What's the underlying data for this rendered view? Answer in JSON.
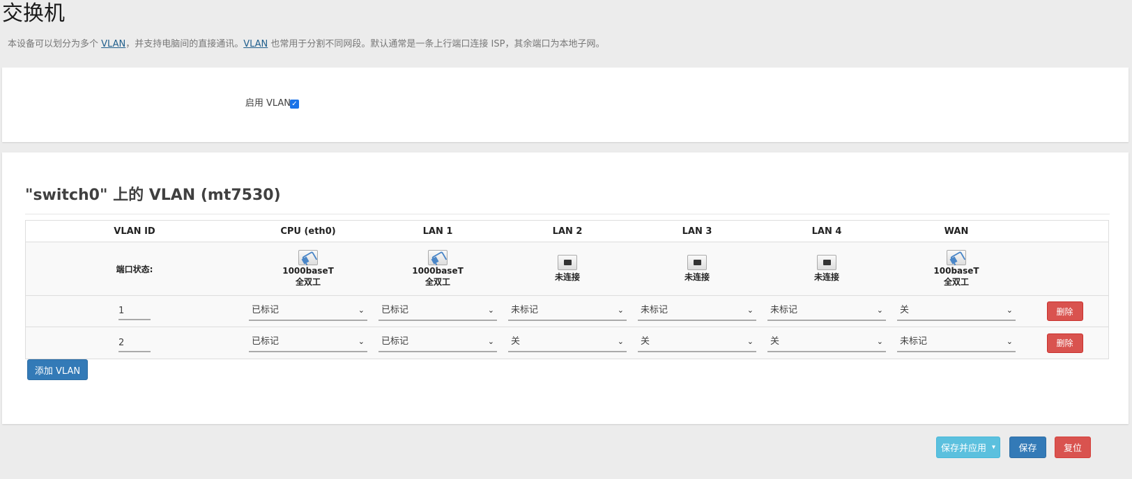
{
  "page": {
    "title": "交换机",
    "desc_part1": "本设备可以划分为多个 ",
    "desc_link1": "VLAN",
    "desc_part2": "，并支持电脑间的直接通讯。",
    "desc_link2": "VLAN",
    "desc_part3": " 也常用于分割不同网段。默认通常是一条上行端口连接 ISP，其余端口为本地子网。"
  },
  "enable": {
    "label": "启用 VLAN",
    "checked": true,
    "check_glyph": "✓"
  },
  "vlan_section": {
    "title": "\"switch0\" 上的 VLAN (mt7530)",
    "headers": [
      "VLAN ID",
      "CPU (eth0)",
      "LAN 1",
      "LAN 2",
      "LAN 3",
      "LAN 4",
      "WAN"
    ],
    "status_label": "端口状态:",
    "port_status": [
      {
        "icon": "port-connected-icon",
        "line1": "1000baseT",
        "line2": "全双工",
        "up": true
      },
      {
        "icon": "port-connected-icon",
        "line1": "1000baseT",
        "line2": "全双工",
        "up": true
      },
      {
        "icon": "port-disconnected-icon",
        "line1": "未连接",
        "line2": "",
        "up": false
      },
      {
        "icon": "port-disconnected-icon",
        "line1": "未连接",
        "line2": "",
        "up": false
      },
      {
        "icon": "port-disconnected-icon",
        "line1": "未连接",
        "line2": "",
        "up": false
      },
      {
        "icon": "port-connected-icon",
        "line1": "100baseT",
        "line2": "全双工",
        "up": true
      }
    ],
    "rows": [
      {
        "vid": "1",
        "ports": [
          "已标记",
          "已标记",
          "未标记",
          "未标记",
          "未标记",
          "关"
        ],
        "delete_label": "删除"
      },
      {
        "vid": "2",
        "ports": [
          "已标记",
          "已标记",
          "关",
          "关",
          "关",
          "未标记"
        ],
        "delete_label": "删除"
      }
    ],
    "add_label": "添加 VLAN"
  },
  "footer": {
    "save_apply_label": "保存并应用",
    "caret": "▾",
    "save_label": "保存",
    "reset_label": "复位"
  },
  "colors": {
    "primary": "#337ab7",
    "info": "#5bc0de",
    "danger": "#d9534f",
    "link": "#1f5e8c"
  }
}
